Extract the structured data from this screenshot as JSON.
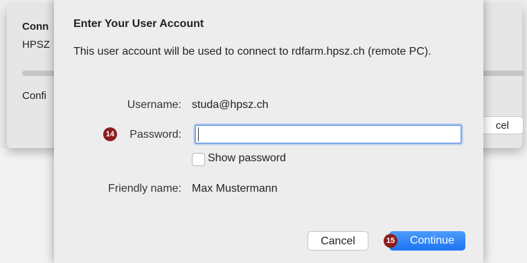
{
  "background_window": {
    "title": "Conn",
    "subtitle": "HPSZ",
    "config_text": "Confi",
    "cancel_label": "cel"
  },
  "dialog": {
    "title": "Enter Your User Account",
    "description": "This user account will be used to connect to rdfarm.hpsz.ch (remote PC).",
    "username_label": "Username:",
    "username_value": "studa@hpsz.ch",
    "password_label": "Password:",
    "password_value": "",
    "show_password_label": "Show password",
    "show_password_checked": false,
    "friendly_name_label": "Friendly name:",
    "friendly_name_value": "Max Mustermann",
    "cancel_label": "Cancel",
    "continue_label": "Continue"
  },
  "annotations": {
    "password_marker": "14",
    "continue_marker": "15"
  },
  "colors": {
    "accent": "#1d73f2",
    "marker": "#8b1d1d",
    "focus_ring": "#7aa7e8"
  }
}
